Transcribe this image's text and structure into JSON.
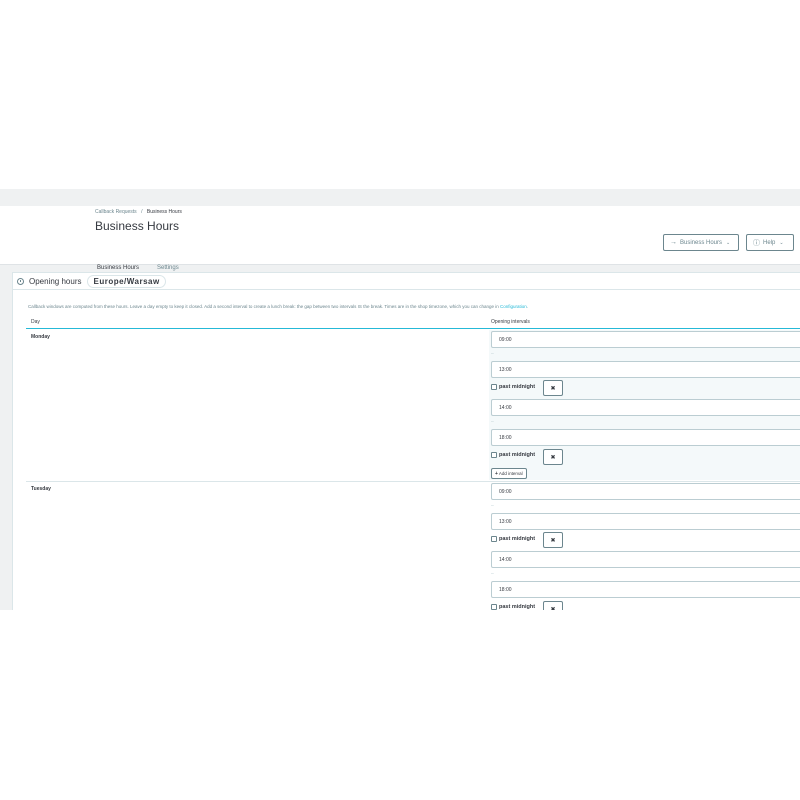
{
  "breadcrumb": {
    "parent": "Callback Requests",
    "separator": "/",
    "current": "Business Hours"
  },
  "page_title": "Business Hours",
  "toolbar": {
    "business_hours_button": {
      "icon": "arrow-right-icon",
      "label": "Business Hours"
    },
    "help_button": {
      "icon": "question-circle-icon",
      "label": "Help"
    }
  },
  "tabs": [
    {
      "label": "Business Hours",
      "active": true
    },
    {
      "label": "Settings",
      "active": false
    }
  ],
  "card": {
    "title": "Opening hours",
    "timezone": "Europe/Warsaw",
    "description": "Callback windows are computed from these hours. Leave a day empty to keep it closed. Add a second interval to create a lunch break: the gap between two intervals IS the break. Times are in the shop timezone, which you can change in ",
    "description_link": "Configuration",
    "description_end": ".",
    "table": {
      "col_day": "Day",
      "col_intervals": "Opening intervals"
    }
  },
  "labels": {
    "separator": "–",
    "past_midnight": "past midnight",
    "remove": "✖",
    "add_interval": "Add interval"
  },
  "days": [
    {
      "name": "Monday",
      "intervals": [
        {
          "start": "09:00",
          "end": "13:00",
          "past_midnight": false
        },
        {
          "start": "14:00",
          "end": "18:00",
          "past_midnight": false
        }
      ]
    },
    {
      "name": "Tuesday",
      "intervals": [
        {
          "start": "09:00",
          "end": "13:00",
          "past_midnight": false
        },
        {
          "start": "14:00",
          "end": "18:00",
          "past_midnight": false
        }
      ]
    }
  ],
  "colors": {
    "accent": "#25b9d7",
    "text": "#363a41",
    "muted": "#6c868e",
    "border": "#bbcdd2",
    "page_bg": "#eff1f2"
  }
}
